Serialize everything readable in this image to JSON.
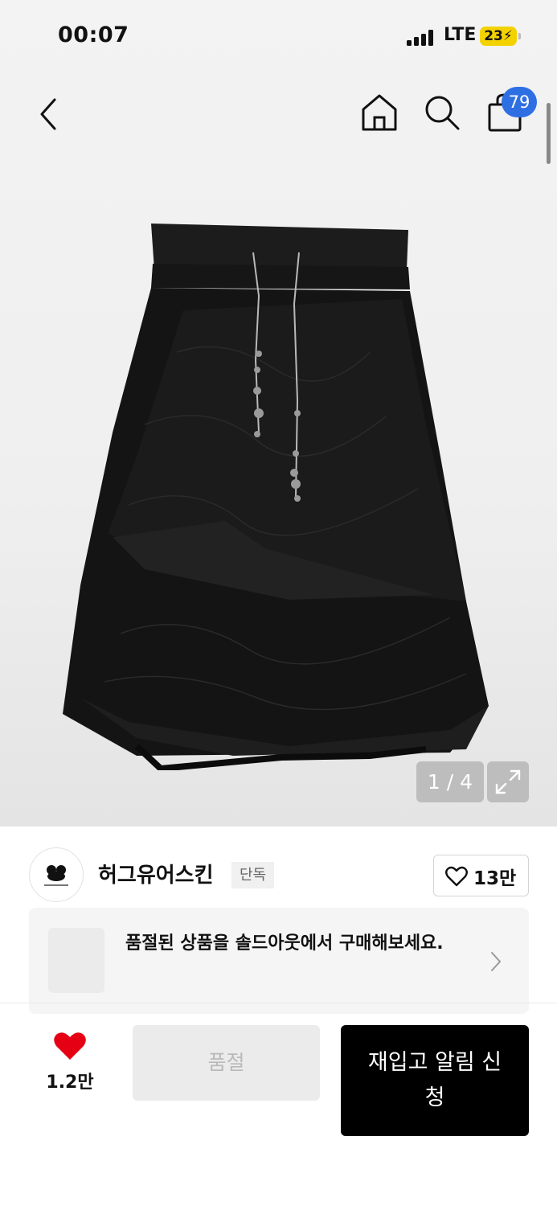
{
  "status_bar": {
    "time": "00:07",
    "network": "LTE",
    "battery": "23"
  },
  "header": {
    "icons": [
      "back-arrow-icon",
      "home-icon",
      "search-icon",
      "shopping-bag-icon"
    ],
    "cart_badge": "79"
  },
  "gallery": {
    "counter": "1 / 4",
    "expand_icon": "expand-icon"
  },
  "brand": {
    "name": "허그유어스킨",
    "tag": "단독",
    "like_count": "13만"
  },
  "soldout_banner": {
    "text": "품절된 상품을 솔드아웃에서 구매해보세요."
  },
  "bottom_bar": {
    "wish_count": "1.2만",
    "soldout_label": "품절",
    "restock_label": "재입고 알림 신청"
  },
  "colors": {
    "badge": "#2f6fe4",
    "heart": "#e60013",
    "primary_button": "#000000"
  }
}
